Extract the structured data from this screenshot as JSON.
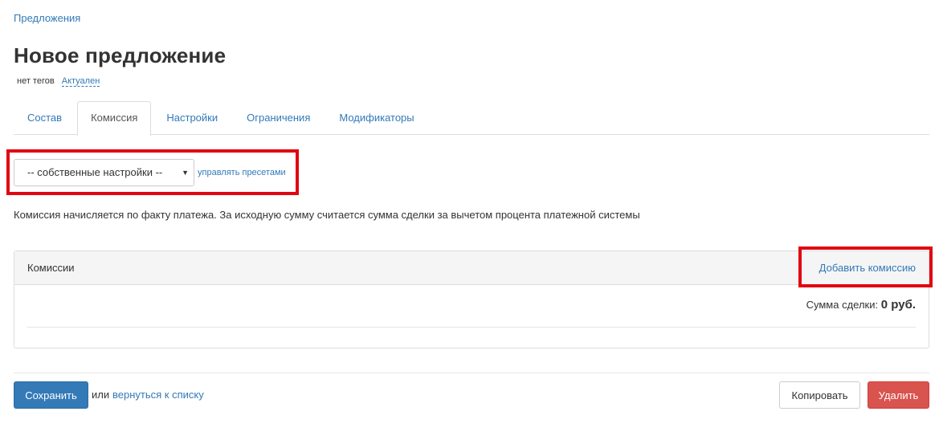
{
  "breadcrumb": {
    "label": "Предложения"
  },
  "page": {
    "title": "Новое предложение",
    "tags_label": "нет тегов",
    "status_label": "Актуален"
  },
  "tabs": [
    {
      "label": "Состав",
      "active": false
    },
    {
      "label": "Комиссия",
      "active": true
    },
    {
      "label": "Настройки",
      "active": false
    },
    {
      "label": "Ограничения",
      "active": false
    },
    {
      "label": "Модификаторы",
      "active": false
    }
  ],
  "preset": {
    "selected": "-- собственные настройки --",
    "manage_link": "управлять пресетами"
  },
  "info_text": "Комиссия начисляется по факту платежа. За исходную сумму считается сумма сделки за вычетом процента платежной системы",
  "commissions_panel": {
    "title": "Комиссии",
    "add_link": "Добавить комиссию",
    "sum_label": "Сумма сделки:",
    "sum_value": "0 руб."
  },
  "footer": {
    "save_label": "Сохранить",
    "or_text": "или",
    "back_link": "вернуться к списку",
    "copy_label": "Копировать",
    "delete_label": "Удалить"
  },
  "colors": {
    "link": "#337ab7",
    "primary": "#337ab7",
    "danger": "#d9534f",
    "highlight": "#e10612"
  }
}
